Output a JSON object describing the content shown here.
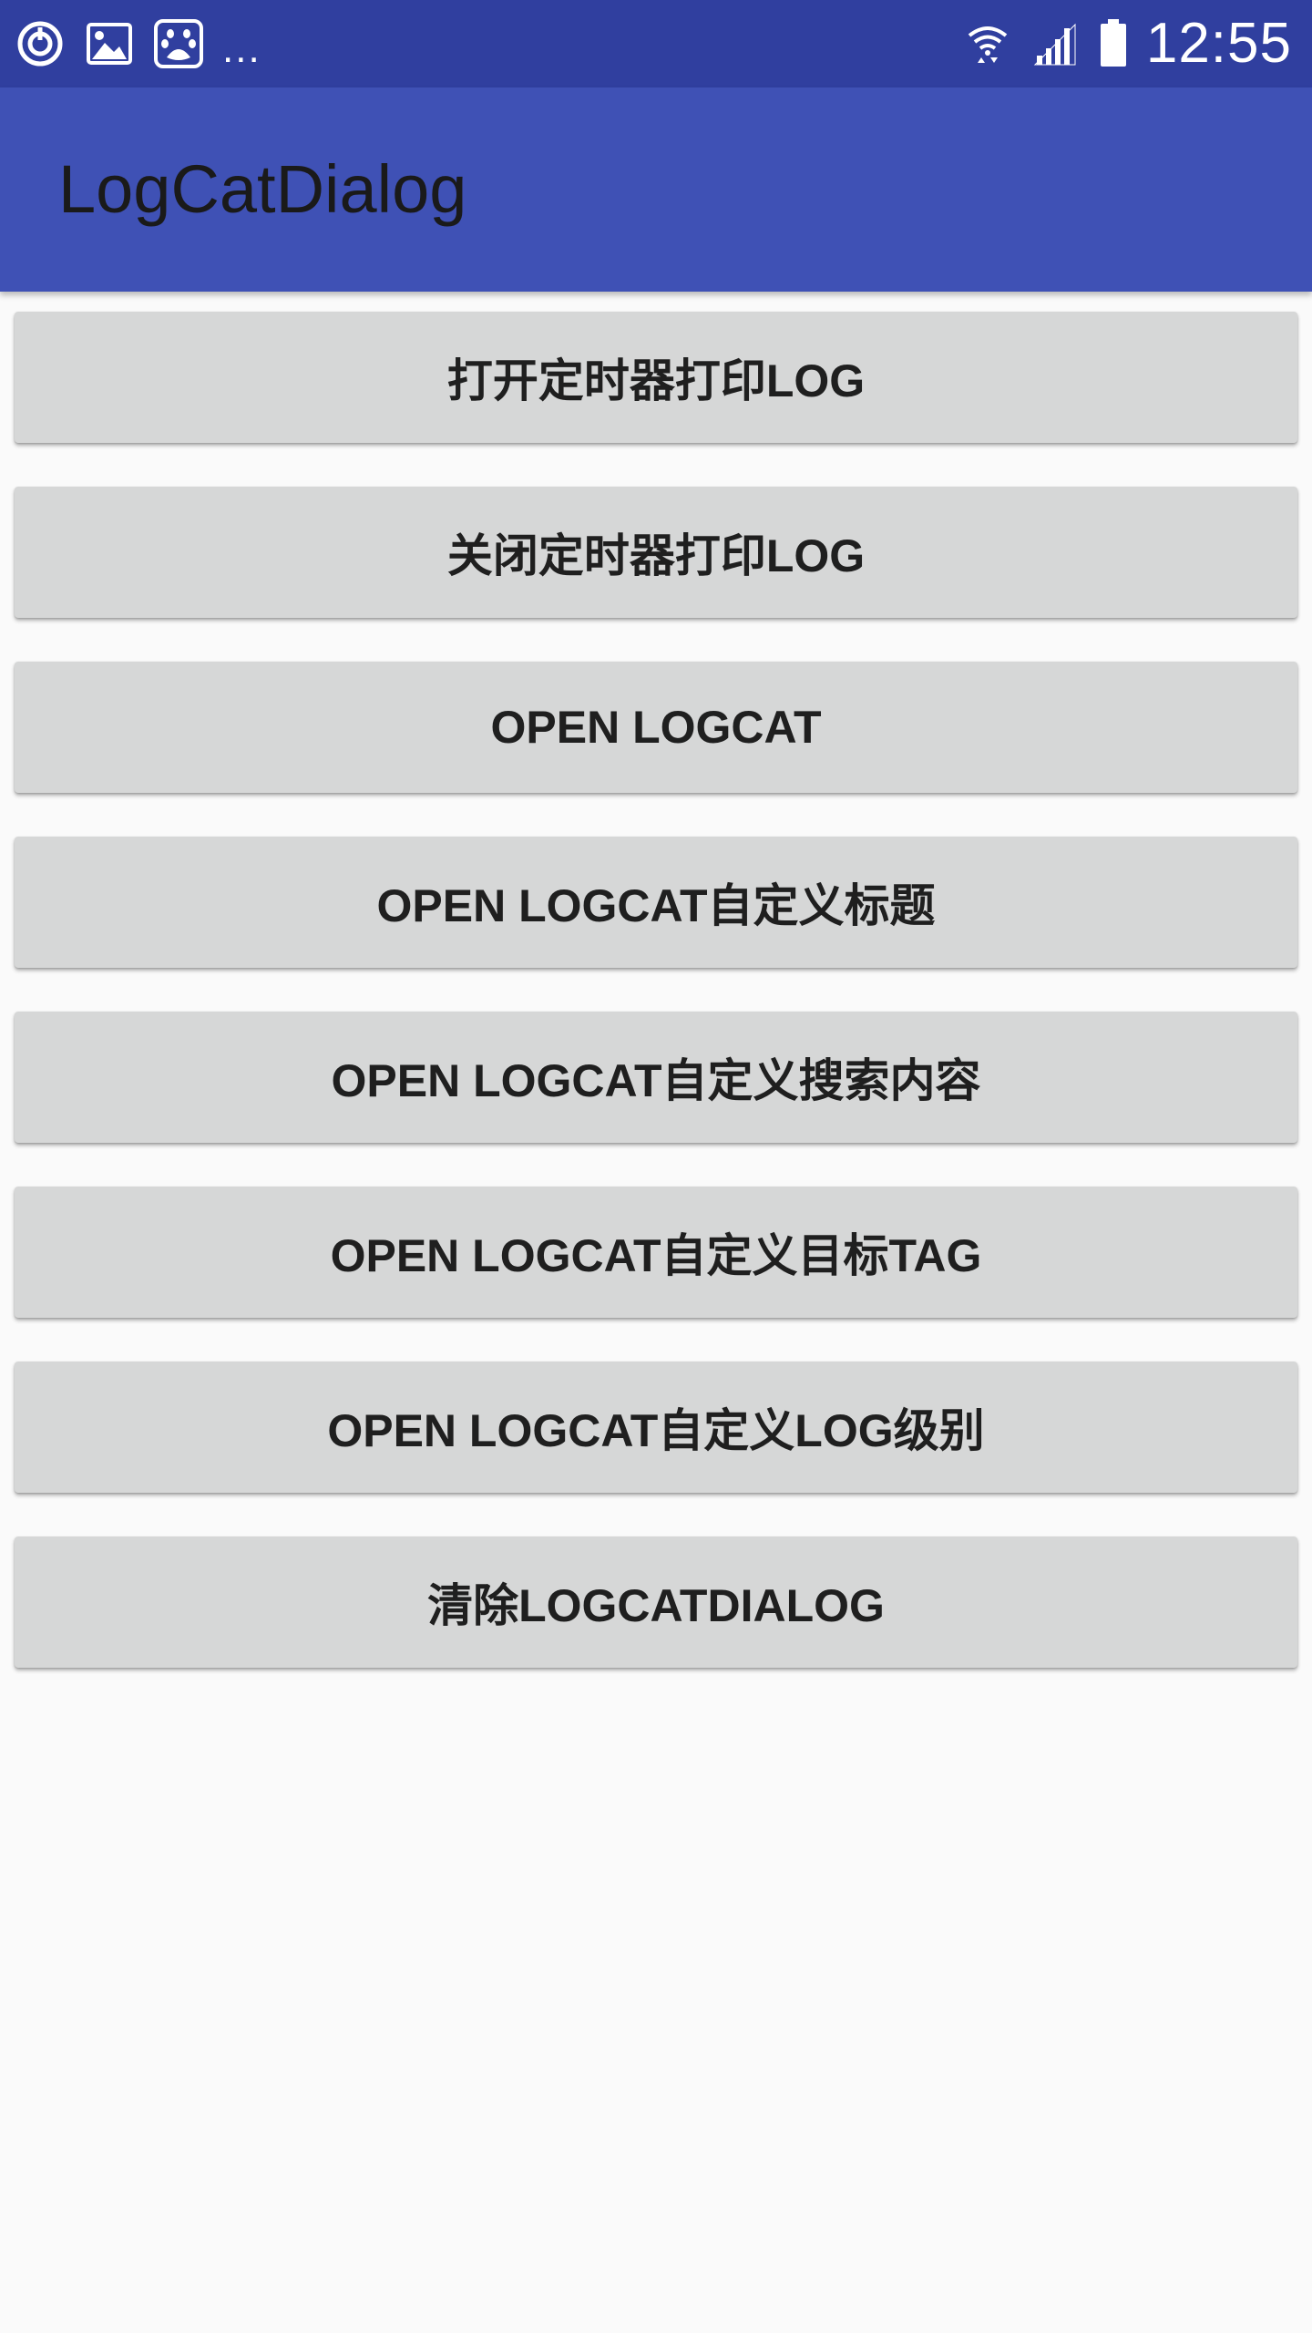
{
  "status_bar": {
    "time": "12:55",
    "more_indicator": "...",
    "left_icons": [
      "sync-icon",
      "image-icon",
      "baidu-paw-icon"
    ],
    "right_icons": [
      "wifi-icon",
      "signal-icon",
      "battery-icon"
    ],
    "background_color": "#303f9f"
  },
  "app_bar": {
    "title": "LogCatDialog",
    "background_color": "#3f51b5"
  },
  "buttons": [
    {
      "label": "打开定时器打印LOG"
    },
    {
      "label": "关闭定时器打印LOG"
    },
    {
      "label": "OPEN LOGCAT"
    },
    {
      "label": "OPEN LOGCAT自定义标题"
    },
    {
      "label": "OPEN LOGCAT自定义搜索内容"
    },
    {
      "label": "OPEN LOGCAT自定义目标TAG"
    },
    {
      "label": "OPEN LOGCAT自定义LOG级别"
    },
    {
      "label": "清除LOGCATDIALOG"
    }
  ],
  "colors": {
    "button_background": "#d6d7d7",
    "page_background": "#fafafa"
  }
}
